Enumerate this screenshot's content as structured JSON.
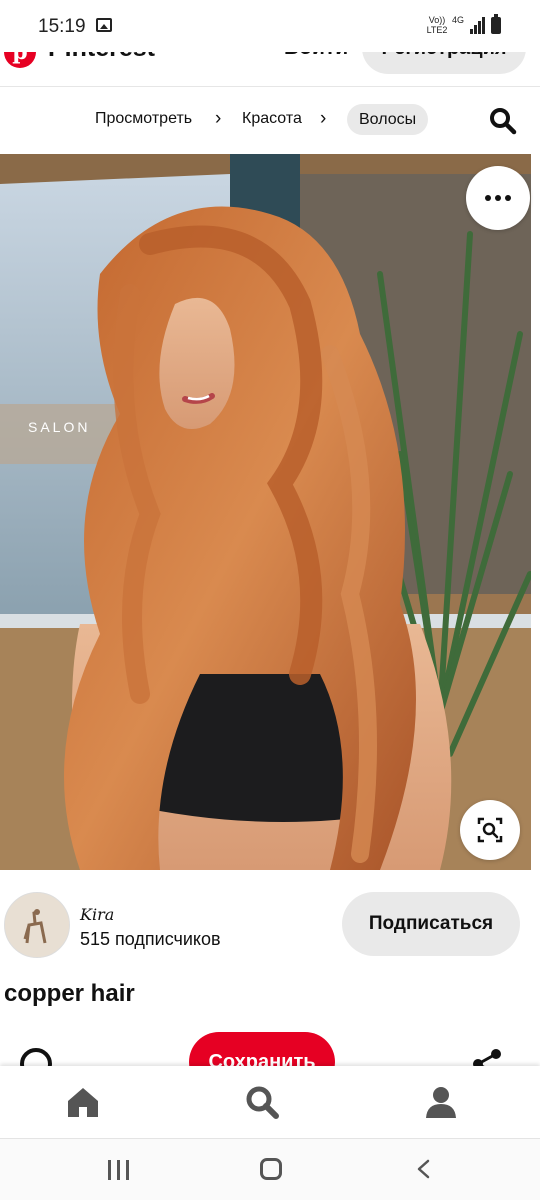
{
  "status_bar": {
    "time": "15:19",
    "network_volte": "Vo)) LTE2",
    "network_4g": "4G"
  },
  "header": {
    "logo_text": "Pinterest",
    "login_label": "Войти",
    "signup_label": "Регистрация"
  },
  "breadcrumb": {
    "items": [
      "Просмотреть",
      "Красота",
      "Волосы"
    ]
  },
  "pin": {
    "author_name": "Kira",
    "followers": "515 подписчиков",
    "follow_label": "Подписаться",
    "title": "copper hair",
    "save_label": "Сохранить",
    "image_overlay_text": "SALON"
  },
  "icons": {
    "more": "more-options-icon",
    "visual_search": "visual-search-icon",
    "comment": "comment-icon",
    "share": "share-icon",
    "home": "home-icon",
    "search": "search-icon",
    "profile": "profile-icon"
  },
  "colors": {
    "brand_red": "#e60023",
    "chip_gray": "#e9e9e9"
  }
}
